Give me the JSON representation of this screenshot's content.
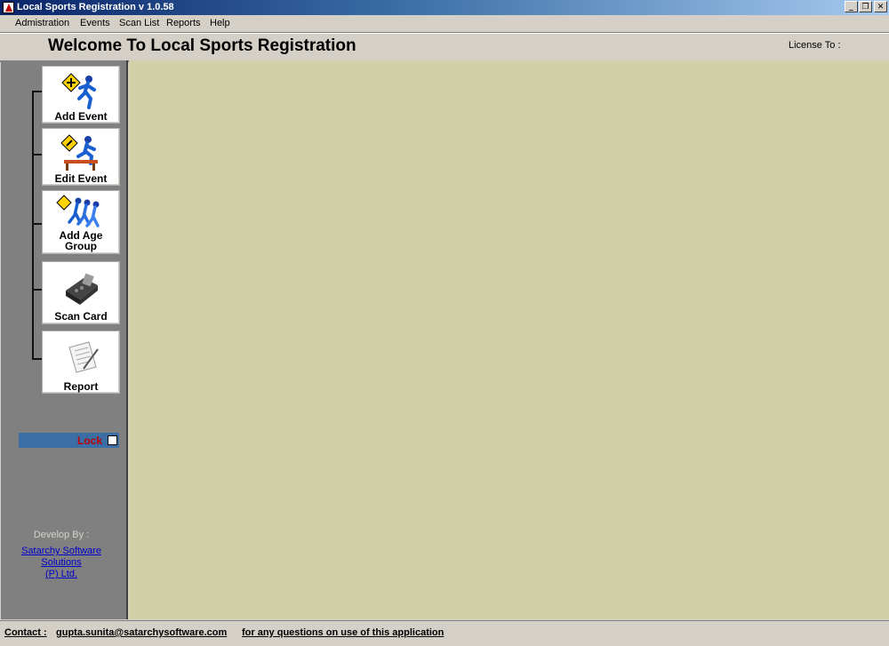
{
  "window": {
    "title": "Local Sports Registration v 1.0.58",
    "buttons": {
      "minimize": "_",
      "restore": "❐",
      "close": "✕"
    }
  },
  "menu": [
    "Admistration",
    "Events",
    "Scan List",
    "Reports",
    "Help"
  ],
  "header": {
    "title": "Welcome To Local Sports Registration",
    "license": "License To :"
  },
  "sidebar": {
    "buttons": [
      {
        "label": "Add Event",
        "icon": "add-event-icon"
      },
      {
        "label": "Edit Event",
        "icon": "edit-event-icon"
      },
      {
        "label": "Add Age",
        "label2": "Group",
        "icon": "age-group-icon"
      },
      {
        "label": "Scan Card",
        "icon": "card-scanner-icon"
      },
      {
        "label": "Report",
        "icon": "report-icon"
      }
    ],
    "lock_label": "Lock",
    "develop_by": "Develop By :",
    "company_line1": "Satarchy Software Solutions",
    "company_line2": "(P) Ltd."
  },
  "status": {
    "contact_label": "Contact :",
    "email": "gupta.sunita@satarchysoftware.com",
    "note": "for any questions on use of this application"
  },
  "colors": {
    "main_background": "#d0d1a8",
    "sidebar_background": "#808080",
    "titlebar": "#0a246a",
    "lock_bar": "#3a6ea5",
    "lock_text": "#c00000",
    "link": "#0000cc"
  }
}
